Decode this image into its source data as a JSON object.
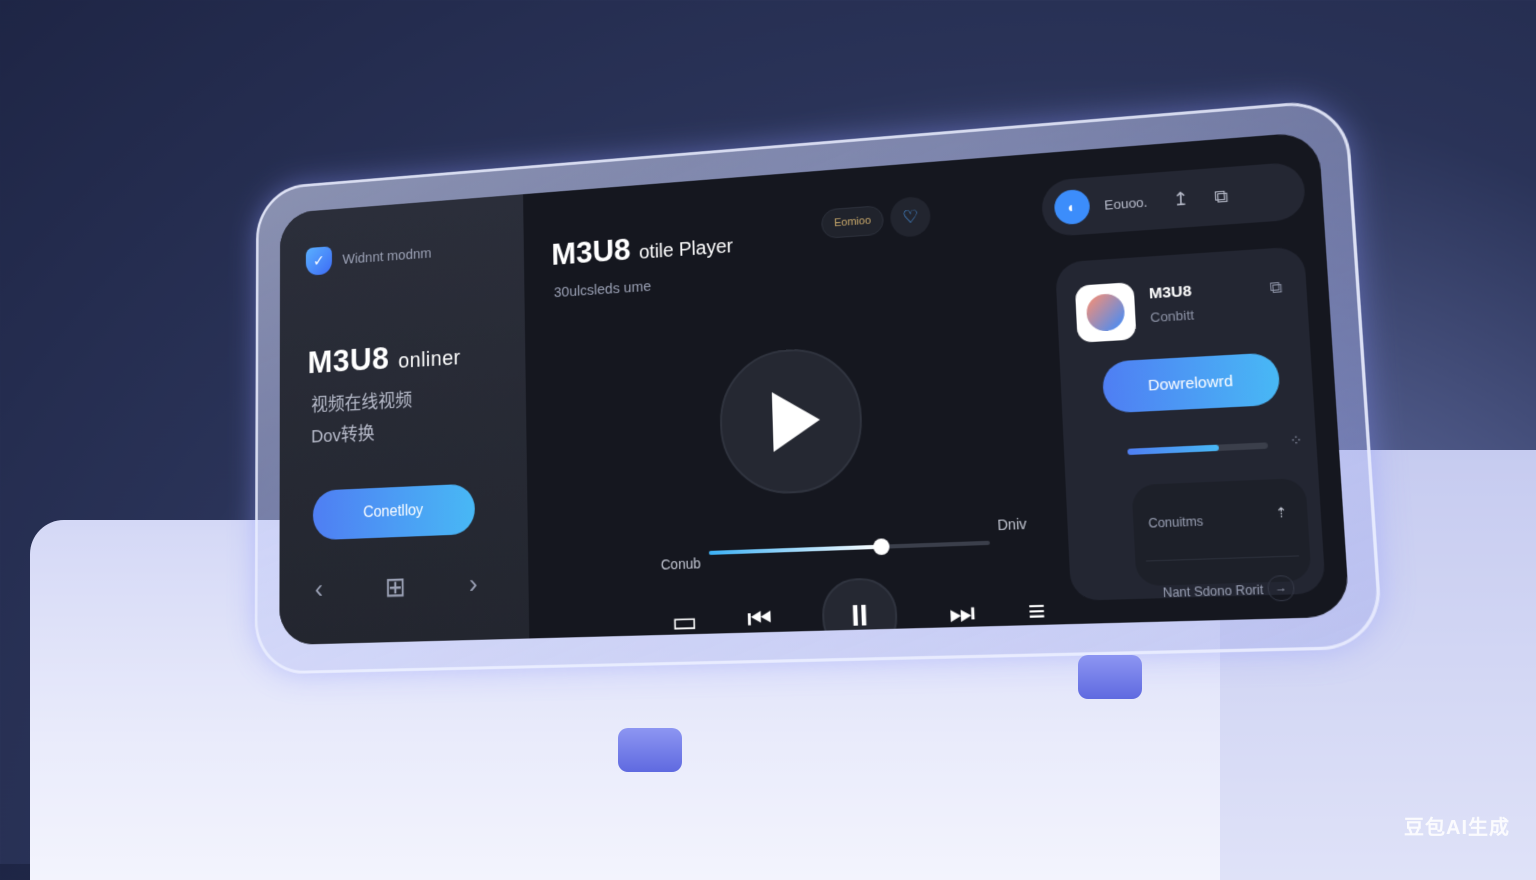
{
  "left_panel": {
    "brand_name": "Widnnt modnm",
    "title_main": "M3U8",
    "title_suffix": "onliner",
    "line1": "视频在线视频",
    "line2": "Dov转换",
    "cta_label": "Conetlloy",
    "nav": {
      "prev": "‹",
      "grid": "⊞",
      "next": "›"
    }
  },
  "player": {
    "title_main": "M3U8",
    "title_suffix": "otile Player",
    "subtitle": "30ulcsleds ume",
    "chip_label": "Eomioo",
    "heart_icon": "♡",
    "time_current": "Conub",
    "time_end": "Dniv",
    "progress": 0.62
  },
  "controls": {
    "screen": "▭",
    "prev": "⏮",
    "pause": "II",
    "next": "⏭",
    "menu": "≡"
  },
  "topbar": {
    "label": "Eouoo.",
    "icons": [
      "↥",
      "⧉"
    ]
  },
  "download_card": {
    "app_title": "M3U8",
    "app_sub": "Conbitt",
    "button_label": "Dowrelowrd",
    "download_progress": 0.65,
    "row1_label": "Conuitms",
    "row2_label": "Nant Sdono Rorit"
  },
  "watermark": "豆包AI生成",
  "colors": {
    "accent_start": "#4f7ef3",
    "accent_end": "#48b8f5",
    "screen_bg": "#15171f"
  }
}
